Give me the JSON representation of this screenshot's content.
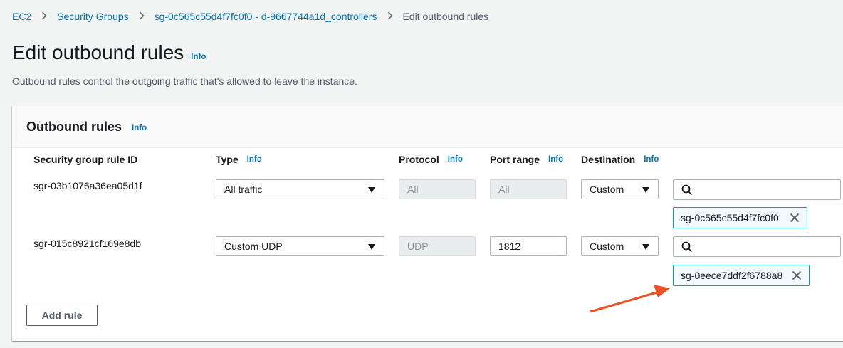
{
  "breadcrumb": {
    "items": [
      "EC2",
      "Security Groups",
      "sg-0c565c55d4f7fc0f0 - d-9667744a1d_controllers",
      "Edit outbound rules"
    ]
  },
  "page": {
    "title": "Edit outbound rules",
    "info": "Info",
    "description": "Outbound rules control the outgoing traffic that's allowed to leave the instance."
  },
  "panel": {
    "title": "Outbound rules",
    "info": "Info",
    "columns": {
      "rule_id": "Security group rule ID",
      "type": "Type",
      "protocol": "Protocol",
      "port_range": "Port range",
      "destination": "Destination",
      "info": "Info"
    },
    "rules": [
      {
        "id": "sgr-03b1076a36ea05d1f",
        "type": "All traffic",
        "protocol": "All",
        "port_range": "All",
        "destination": "Custom",
        "search_value": "",
        "token": "sg-0c565c55d4f7fc0f0"
      },
      {
        "id": "sgr-015c8921cf169e8db",
        "type": "Custom UDP",
        "protocol": "UDP",
        "port_range": "1812",
        "destination": "Custom",
        "search_value": "",
        "token": "sg-0eece7ddf2f6788a8"
      }
    ],
    "add_rule_label": "Add rule"
  },
  "icons": {
    "separator": "chevron-right-icon",
    "dropdown": "caret-down-icon",
    "search": "search-icon",
    "remove": "close-icon"
  },
  "colors": {
    "link": "#0073bb",
    "annotation_arrow": "#f04e23",
    "token_border": "#00a1c9"
  }
}
